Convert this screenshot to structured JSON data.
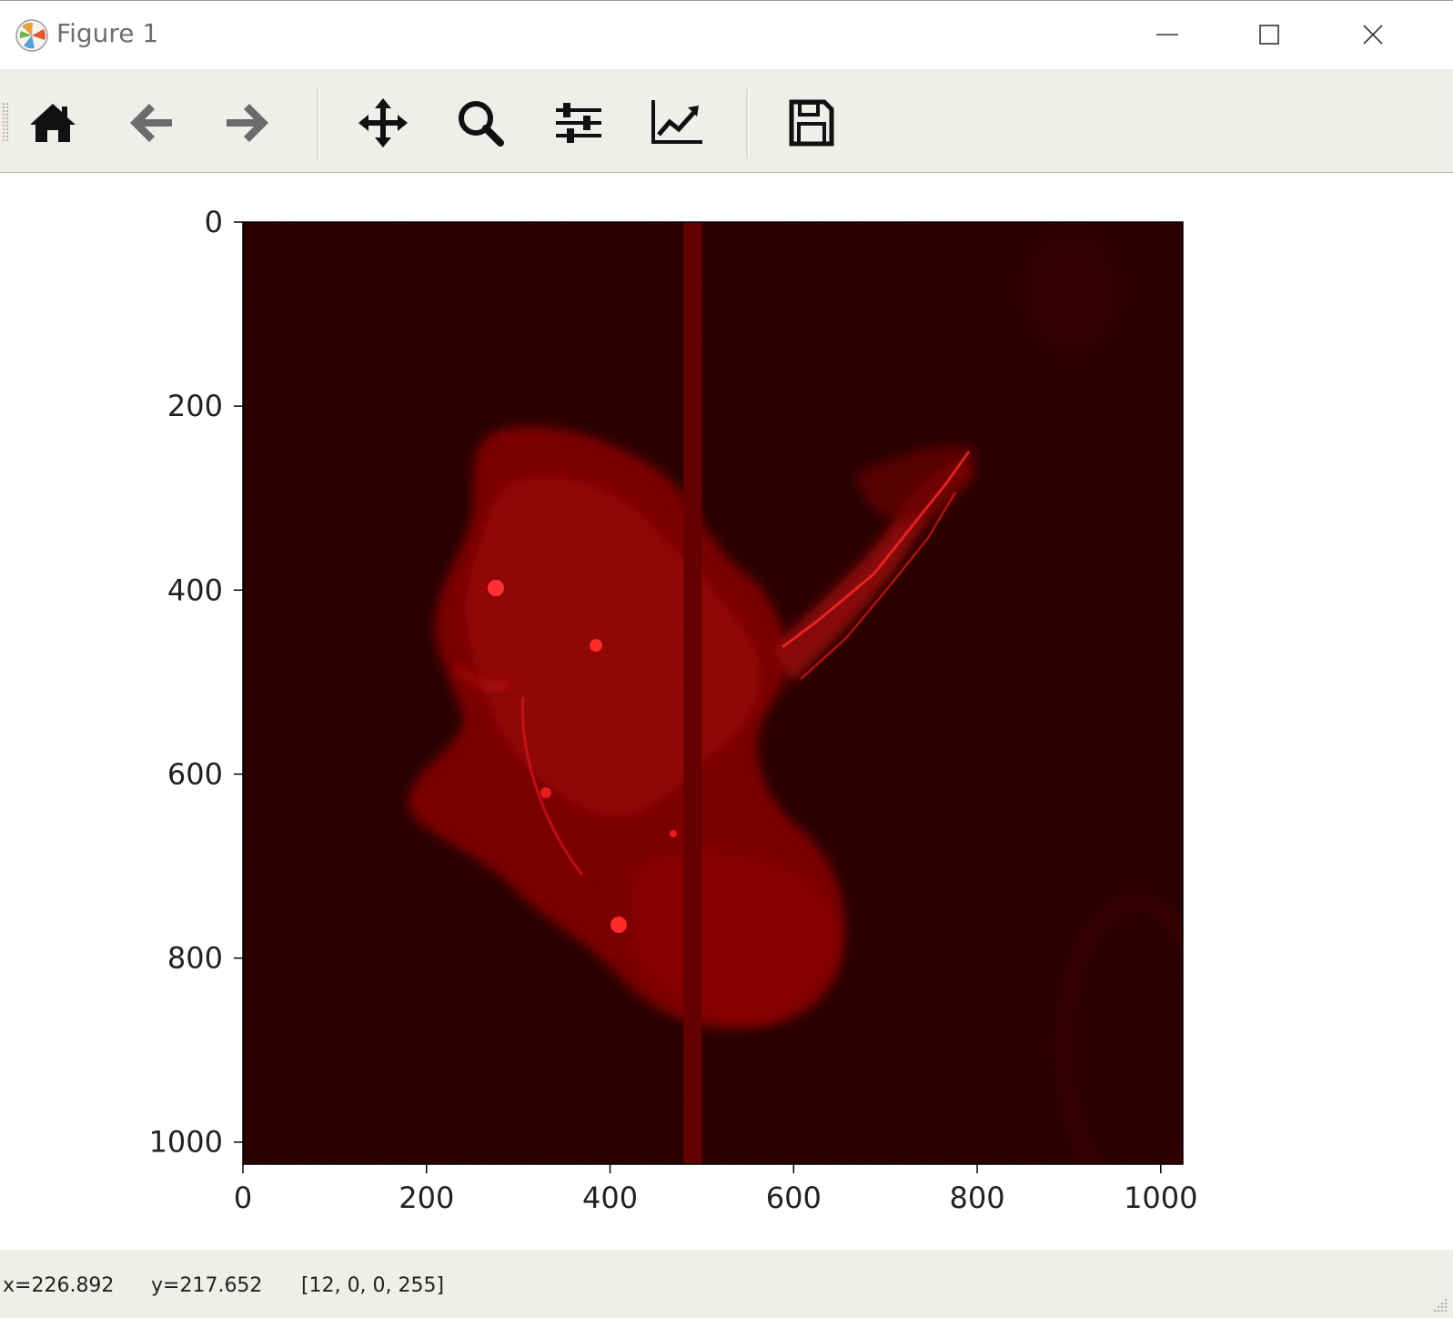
{
  "window": {
    "title": "Figure 1",
    "app_icon": "matplotlib-logo-icon",
    "controls": [
      "minimize-icon",
      "maximize-icon",
      "close-icon"
    ]
  },
  "toolbar": {
    "buttons": [
      {
        "name": "home",
        "icon": "home-icon"
      },
      {
        "name": "back",
        "icon": "arrow-left-icon"
      },
      {
        "name": "forward",
        "icon": "arrow-right-icon"
      },
      {
        "name": "pan",
        "icon": "move-icon"
      },
      {
        "name": "zoom",
        "icon": "magnifier-icon"
      },
      {
        "name": "configure-subplots",
        "icon": "sliders-icon"
      },
      {
        "name": "edit-axis",
        "icon": "line-chart-icon"
      },
      {
        "name": "save",
        "icon": "floppy-disk-icon"
      }
    ]
  },
  "chart_data": {
    "type": "heatmap",
    "title": "",
    "xlabel": "",
    "ylabel": "",
    "colormap": "black-to-red",
    "xlim": [
      0,
      1024
    ],
    "ylim": [
      1024,
      0
    ],
    "x_ticks": [
      "0",
      "200",
      "400",
      "600",
      "800",
      "1000"
    ],
    "y_ticks": [
      "0",
      "200",
      "400",
      "600",
      "800",
      "1000"
    ],
    "background_color": "#0f0000",
    "signal_color": "#e01010",
    "stripe": {
      "x_start": 480,
      "x_end": 500,
      "color": "#650000"
    }
  },
  "status": {
    "x": "x=226.892",
    "y": "y=217.652",
    "pixel": "[12, 0, 0, 255]"
  }
}
